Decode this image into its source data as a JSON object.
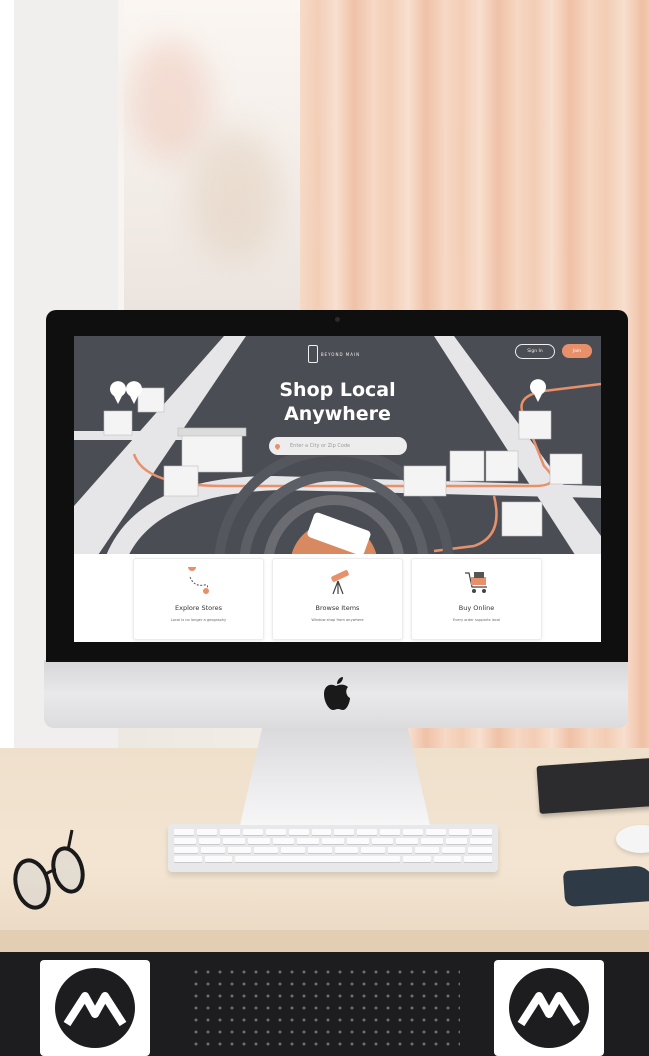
{
  "website": {
    "brand": "BEYOND MAIN",
    "nav": {
      "signin_label": "Sign In",
      "join_label": "Join"
    },
    "hero": {
      "title_line1": "Shop Local",
      "title_line2": "Anywhere",
      "search_placeholder": "Enter a City or Zip Code"
    },
    "cards": [
      {
        "title": "Explore Stores",
        "subtitle": "Local is no longer a geography",
        "icon": "map-route-icon"
      },
      {
        "title": "Browse Items",
        "subtitle": "Window shop from anywhere",
        "icon": "telescope-icon"
      },
      {
        "title": "Buy Online",
        "subtitle": "Every order supports local",
        "icon": "shopping-cart-icon"
      }
    ]
  },
  "colors": {
    "accent": "#e8906a",
    "hero_bg": "#4b4d55",
    "road": "#e6e6e8"
  },
  "objects": [
    "imac",
    "keyboard",
    "eyeglasses",
    "book",
    "mouse",
    "desk"
  ]
}
